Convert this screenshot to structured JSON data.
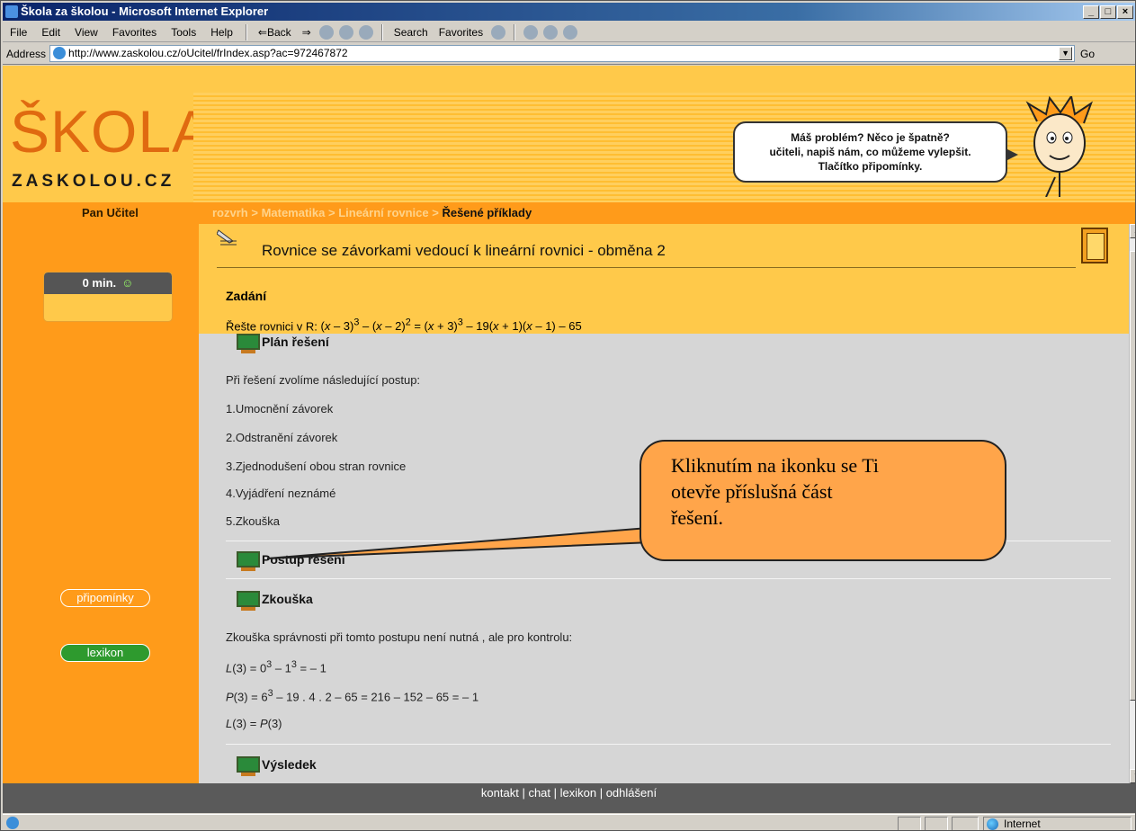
{
  "window": {
    "title": "Škola za školou - Microsoft Internet Explorer",
    "min": "_",
    "max": "□",
    "close": "×"
  },
  "menu": {
    "items": [
      "File",
      "Edit",
      "View",
      "Favorites",
      "Tools",
      "Help"
    ],
    "back": "⇐Back",
    "forward": "⇒",
    "search": "Search",
    "favorites": "Favorites"
  },
  "address": {
    "label": "Address",
    "url": "http://www.zaskolou.cz/oUcitel/frIndex.asp?ac=972467872",
    "go": "Go"
  },
  "logo": {
    "main": "ŠKOLA",
    "sub": "ZASKOLOU.CZ"
  },
  "bubble": {
    "line1": "Máš problém? Něco je špatně?",
    "line2": "učiteli, napiš nám, co můžeme vylepšit.",
    "line3": "Tlačítko připomínky."
  },
  "user": "Pan Učitel",
  "breadcrumb": {
    "links": [
      "rozvrh",
      "Matematika",
      "Lineární rovnice"
    ],
    "sep": " > ",
    "current": "Řešené příklady"
  },
  "timer": {
    "label": "0 min.",
    "smiley": "☺"
  },
  "sidebar": {
    "pripominky": "připomínky",
    "lexikon": "lexikon"
  },
  "content": {
    "title": "Rovnice se závorkami vedoucí k lineární rovnici - obměna 2",
    "zadani": "Zadání",
    "equation_prefix": "Řešte rovnici v R: ",
    "plan_heading": "Plán řešení",
    "plan_intro": "Při řešení zvolíme následující postup:",
    "plan_steps": [
      "1.Umocnění závorek",
      "2.Odstranění závorek",
      "3.Zjednodušení obou stran rovnice",
      "4.Vyjádření neznámé",
      "5.Zkouška"
    ],
    "postup_heading": "Postup řešení",
    "zkouska_heading": "Zkouška",
    "zkouska_intro": "Zkouška správnosti při tomto postupu není nutná , ale pro kontrolu:",
    "vysledek_heading": "Výsledek"
  },
  "callout": {
    "line1": "Kliknutím na  ikonku se Ti",
    "line2": "otevře příslušná část",
    "line3": "řešení."
  },
  "footer": {
    "links": [
      "kontakt",
      "chat",
      "lexikon",
      "odhlášení"
    ]
  },
  "status": {
    "zone": "Internet"
  }
}
